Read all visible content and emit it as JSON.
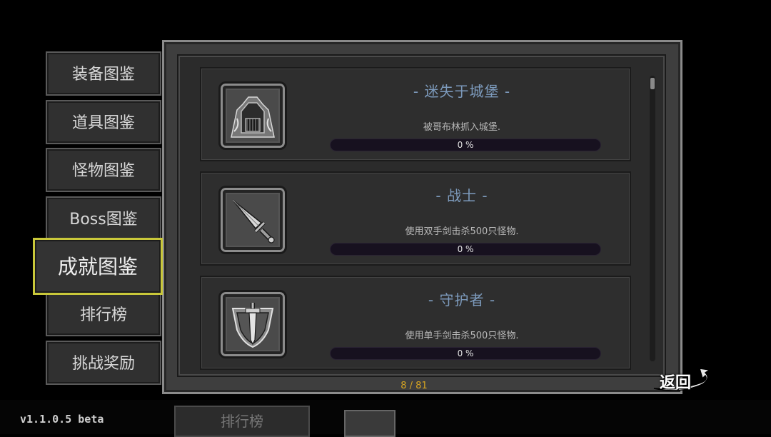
{
  "background": {
    "version": "v1.1.0.5 beta",
    "button_label": "排行榜"
  },
  "tabs": [
    {
      "label": "装备图鉴",
      "active": false
    },
    {
      "label": "道具图鉴",
      "active": false
    },
    {
      "label": "怪物图鉴",
      "active": false
    },
    {
      "label": "Boss图鉴",
      "active": false
    },
    {
      "label": "成就图鉴",
      "active": true
    },
    {
      "label": "排行榜",
      "active": false
    },
    {
      "label": "挑战奖励",
      "active": false
    }
  ],
  "achievements": [
    {
      "title": "- 迷失于城堡 -",
      "description": "被哥布林抓入城堡.",
      "progress_text": "0 %",
      "progress": 0,
      "icon": "castle-icon"
    },
    {
      "title": "- 战士 -",
      "description": "使用双手剑击杀500只怪物.",
      "progress_text": "0 %",
      "progress": 0,
      "icon": "greatsword-icon"
    },
    {
      "title": "- 守护者 -",
      "description": "使用单手剑击杀500只怪物.",
      "progress_text": "0 %",
      "progress": 0,
      "icon": "sword-shield-icon"
    }
  ],
  "page_counter": "8 / 81",
  "back_button": {
    "label": "返回"
  },
  "colors": {
    "active_tab_border": "#c9c83a",
    "title_blue": "#7d9bbd",
    "counter_gold": "#d6a422"
  }
}
